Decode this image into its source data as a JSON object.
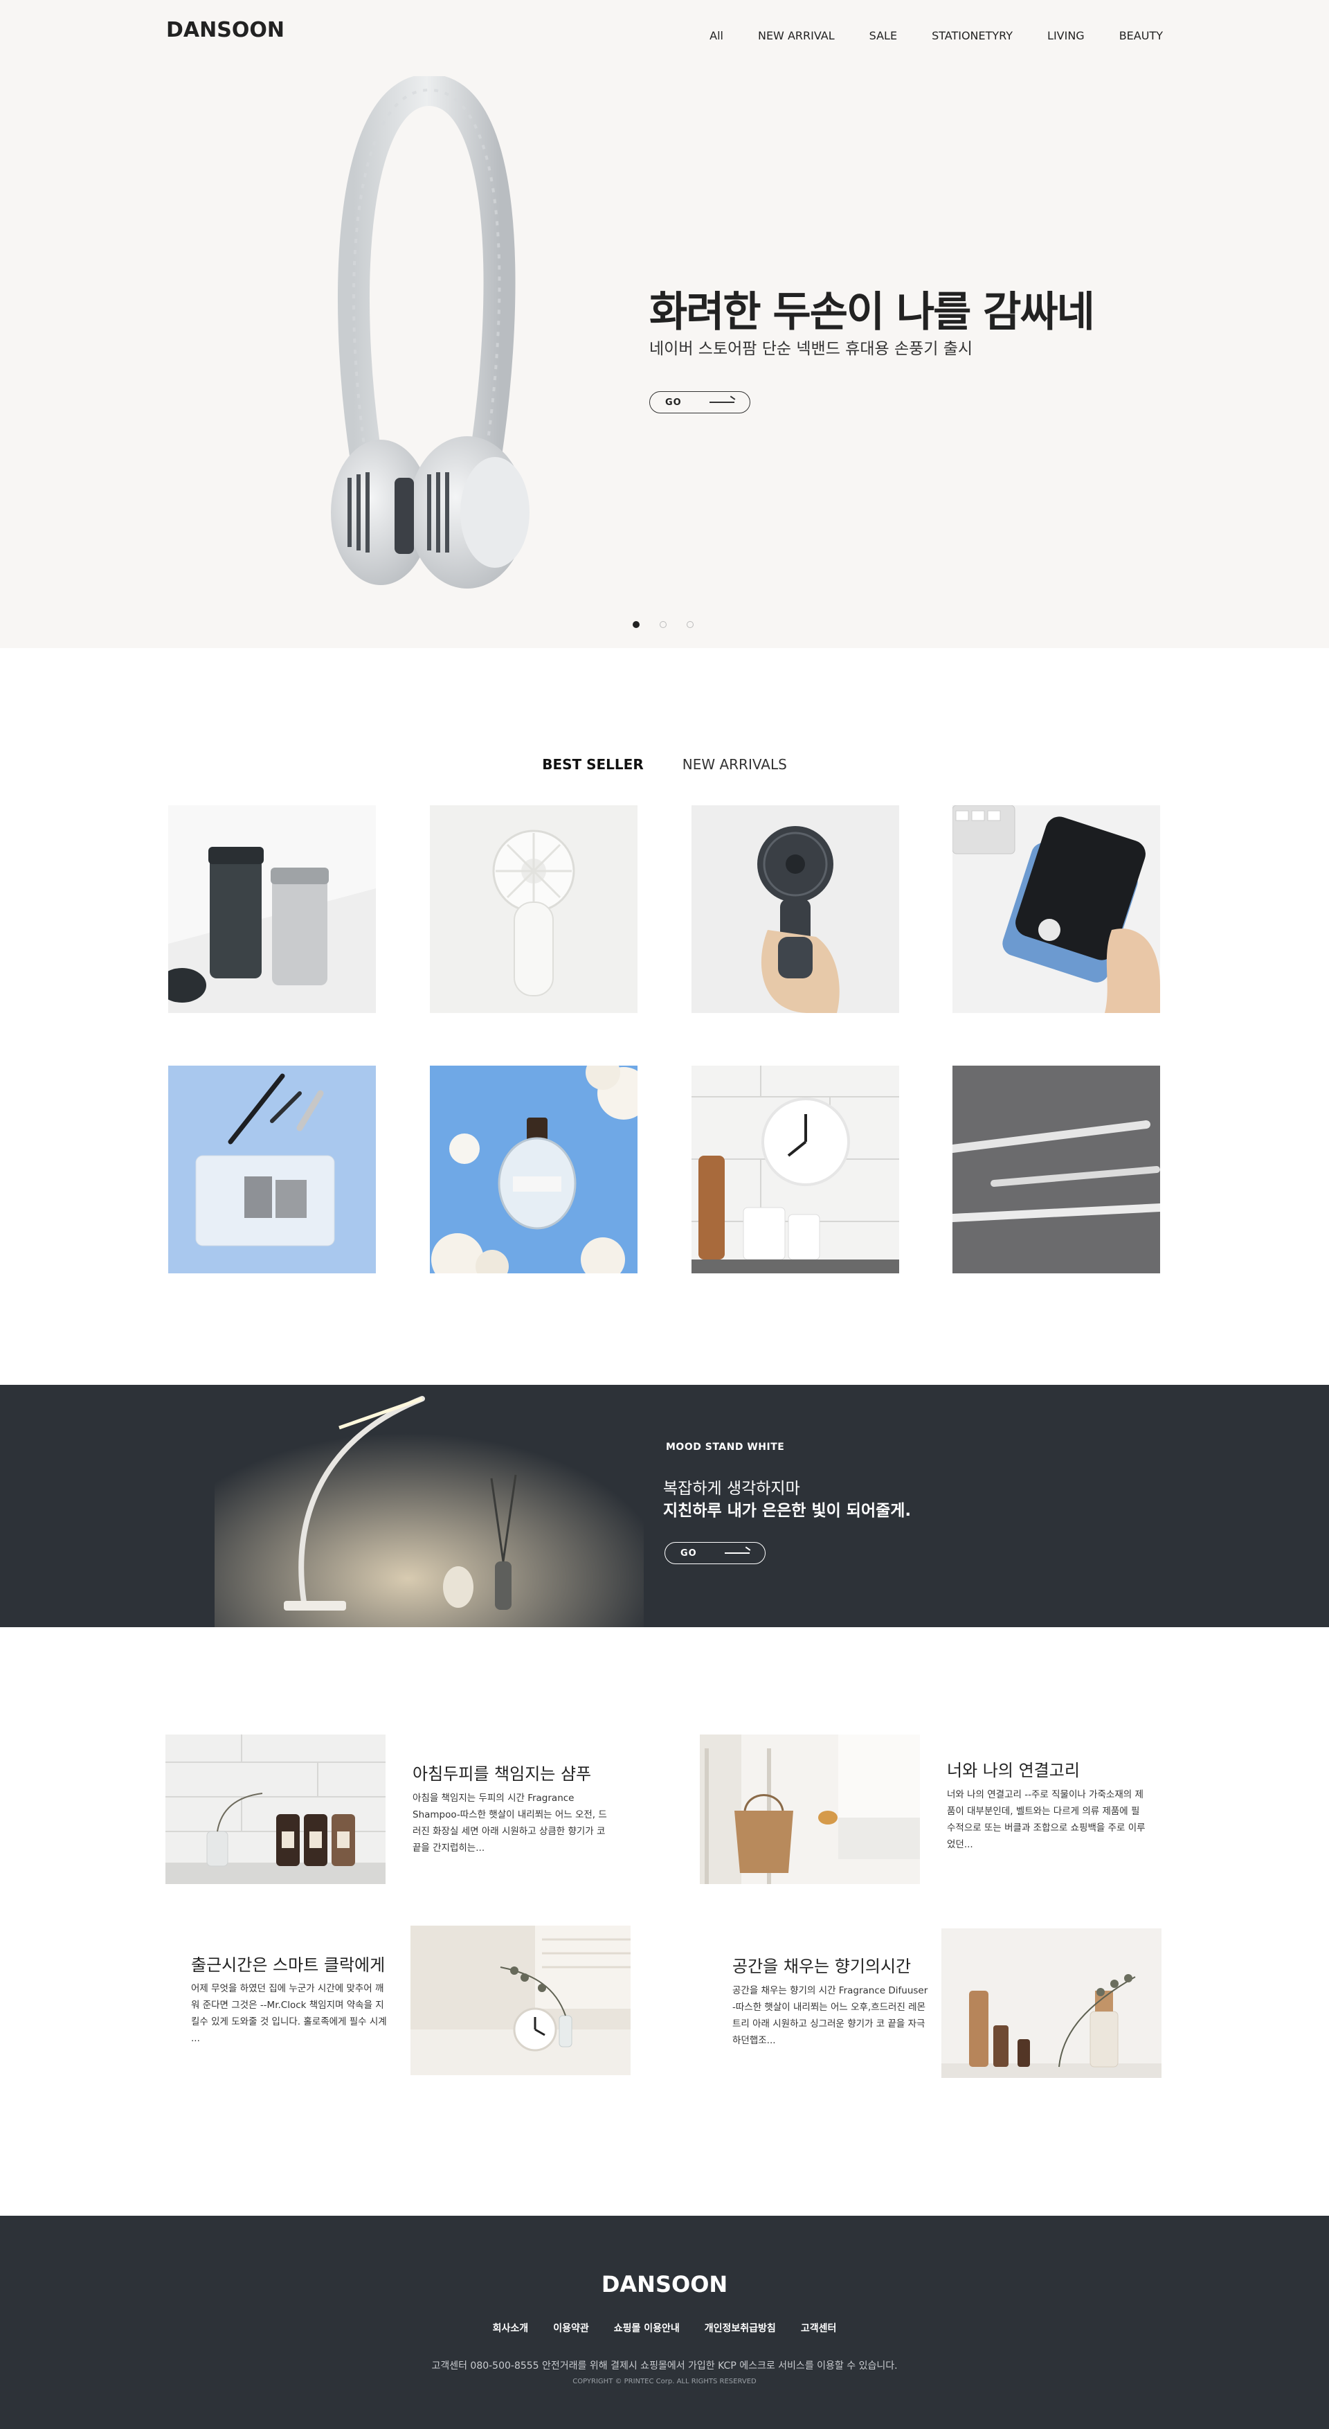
{
  "header": {
    "logo": "DANSOON",
    "nav": [
      "All",
      "NEW ARRIVAL",
      "SALE",
      "STATIONETYRY",
      "LIVING",
      "BEAUTY"
    ]
  },
  "hero": {
    "title": "화려한 두손이 나를 감싸네",
    "subtitle": "네이버 스토어팜 단순 넥밴드 휴대용 손풍기 출시",
    "go_label": "GO",
    "slides": {
      "count": 3,
      "active": 1
    }
  },
  "tabs": {
    "best": "BEST SELLER",
    "new": "NEW ARRIVALS"
  },
  "products": [
    {
      "name": "tumblers-image"
    },
    {
      "name": "white-handheld-fan-image"
    },
    {
      "name": "black-handheld-fan-image"
    },
    {
      "name": "phone-stand-image"
    },
    {
      "name": "pouch-brushes-image"
    },
    {
      "name": "perfume-cotton-image"
    },
    {
      "name": "wall-clock-image"
    },
    {
      "name": "pens-image"
    }
  ],
  "mood": {
    "label": "MOOD STAND WHITE",
    "line1": "복잡하게 생각하지마",
    "line2": "지친하루 내가 은은한 빛이 되어줄게.",
    "go_label": "GO"
  },
  "articles": [
    {
      "title": "아침두피를 책임지는 샴푸",
      "body": "아침을 책임지는 두피의 시간 Fragrance Shampoo-따스한 햇살이 내리쬐는 어느 오전, 드러진 화장실 세면 아래 시원하고 상큼한 향기가 코 끝을 간지럽히는..."
    },
    {
      "title": "너와 나의 연결고리",
      "body": "너와 나의 연결고리 --주로 직물이나 가죽소재의 제품이 대부분인데, 벨트와는 다르게 의류 제품에 필수적으로 또는 버클과 조합으로 쇼핑백을 주로 이루었던..."
    },
    {
      "title": "출근시간은 스마트 클락에게",
      "body": "어제 무엇을 하였던 집에 누군가 시간에 맞추어 깨워 준다면 그것은 --Mr.Clock 책임지며 약속을 지킬수 있게 도와줄 것 입니다. 홀로족에게 필수 시계 ..."
    },
    {
      "title": "공간을 채우는 향기의시간",
      "body": "공간을 채우는 향기의 시간 Fragrance Difuuser -따스한 햇살이 내리쬐는 어느 오후,흐드러진 레몬트리 아래 시원하고 싱그러운 향기가 코 끝을 자극하던햅조..."
    }
  ],
  "footer": {
    "logo": "DANSOON",
    "links": [
      "회사소개",
      "이용약관",
      "쇼핑몰 이용안내",
      "개인정보취급방침",
      "고객센터"
    ],
    "info": "고객센터 080-500-8555 안전거래를 위해 결제시 쇼핑몰에서 가입한 KCP 에스크로 서비스를 이용할 수 있습니다.",
    "copyright": "COPYRIGHT © PRINTEC Corp. ALL RIGHTS RESERVED"
  }
}
